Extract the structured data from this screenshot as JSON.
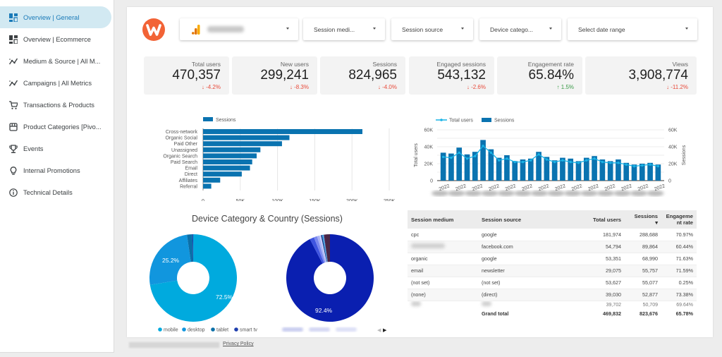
{
  "sidebar": {
    "items": [
      {
        "label": "Overview | General",
        "icon": "dashboard-icon",
        "active": true
      },
      {
        "label": "Overview | Ecommerce",
        "icon": "dashboard-icon",
        "active": false
      },
      {
        "label": "Medium & Source | All M...",
        "icon": "trend-icon",
        "active": false
      },
      {
        "label": "Campaigns | All Metrics",
        "icon": "trend-icon",
        "active": false
      },
      {
        "label": "Transactions & Products",
        "icon": "cart-icon",
        "active": false
      },
      {
        "label": "Product Categories [Pivo...",
        "icon": "store-icon",
        "active": false
      },
      {
        "label": "Events",
        "icon": "trophy-icon",
        "active": false
      },
      {
        "label": "Internal Promotions",
        "icon": "lightbulb-icon",
        "active": false
      },
      {
        "label": "Technical Details",
        "icon": "info-icon",
        "active": false
      }
    ]
  },
  "filters": {
    "account": {
      "icon": "analytics-icon",
      "value": ""
    },
    "session_medium": "Session medi...",
    "session_source": "Session source",
    "device_category": "Device catego...",
    "date_range": "Select date range"
  },
  "colors": {
    "accent": "#1a7ab8",
    "bar": "#0a73b0",
    "line": "#19b3e6",
    "down": "#e84a3a",
    "up": "#3a9a48",
    "logo": "#f26336"
  },
  "kpis": [
    {
      "label": "Total users",
      "value": "470,357",
      "delta": "-4.2%",
      "direction": "down"
    },
    {
      "label": "New users",
      "value": "299,241",
      "delta": "-8.3%",
      "direction": "down"
    },
    {
      "label": "Sessions",
      "value": "824,965",
      "delta": "-4.0%",
      "direction": "down"
    },
    {
      "label": "Engaged sessions",
      "value": "543,132",
      "delta": "-2.6%",
      "direction": "down"
    },
    {
      "label": "Engagement rate",
      "value": "65.84%",
      "delta": "1.5%",
      "direction": "up"
    },
    {
      "label": "Views",
      "value": "3,908,774",
      "delta": "-11.2%",
      "direction": "down"
    }
  ],
  "chart_data": [
    {
      "type": "bar",
      "orientation": "horizontal",
      "legend": [
        "Sessions"
      ],
      "legend_position": "top-left",
      "categories": [
        "Cross-network",
        "Organic Social",
        "Paid Other",
        "Unassigned",
        "Organic Search",
        "Paid Search",
        "Email",
        "Direct",
        "Affiliates",
        "Referral"
      ],
      "values": [
        214000,
        116000,
        106000,
        77000,
        72000,
        66000,
        63000,
        52000,
        23000,
        11000
      ],
      "xlim": [
        0,
        250000
      ],
      "xticks": [
        "0",
        "50K",
        "100K",
        "150K",
        "200K",
        "250K"
      ],
      "grid": true
    },
    {
      "type": "bar+line",
      "legend": [
        "Total users",
        "Sessions"
      ],
      "legend_position": "top-left",
      "ylabel_left": "Total users",
      "ylabel_right": "Sessions",
      "yticks": [
        "0",
        "20K",
        "40K",
        "60K"
      ],
      "ylim": [
        0,
        60000
      ],
      "x_tick_labels": [
        "2022",
        "2022",
        "2022",
        "2022",
        "2022",
        "2022",
        "2022",
        "2022",
        "2022",
        "2022",
        "2022",
        "2022",
        "2022",
        "2022"
      ],
      "series": [
        {
          "name": "Sessions",
          "kind": "bar",
          "values": [
            33000,
            32000,
            39000,
            31000,
            34000,
            48000,
            37000,
            27000,
            30000,
            23000,
            25000,
            26000,
            34000,
            28000,
            24000,
            27000,
            26000,
            23000,
            27000,
            29000,
            25000,
            23000,
            25000,
            21000,
            19000,
            20000,
            21000,
            19000
          ]
        },
        {
          "name": "Total users",
          "kind": "line",
          "values": [
            28000,
            27000,
            33000,
            26000,
            29000,
            41000,
            33000,
            24000,
            26000,
            22000,
            22000,
            24000,
            31000,
            25000,
            22000,
            24000,
            22000,
            21000,
            24000,
            26000,
            22000,
            21000,
            21000,
            19000,
            17000,
            18000,
            19000,
            17000
          ]
        }
      ],
      "grid": true
    },
    {
      "type": "pie",
      "variant": "donut",
      "title": "Device Category & Country (Sessions)",
      "slices": [
        {
          "label": "mobile",
          "value": 72.5,
          "color": "#00aade"
        },
        {
          "label": "desktop",
          "value": 25.2,
          "color": "#1196de"
        },
        {
          "label": "tablet",
          "value": 2.0,
          "color": "#0b6fa8"
        },
        {
          "label": "smart tv",
          "value": 0.3,
          "color": "#1f3fae"
        }
      ],
      "data_labels": [
        "72.5%",
        "25.2%"
      ],
      "legend_position": "bottom"
    },
    {
      "type": "pie",
      "variant": "donut",
      "slices": [
        {
          "label": "",
          "value": 92.4,
          "color": "#0a1fb0"
        },
        {
          "label": "",
          "value": 1.6,
          "color": "#3f55e0"
        },
        {
          "label": "",
          "value": 1.2,
          "color": "#7a88ef"
        },
        {
          "label": "",
          "value": 0.9,
          "color": "#a9b2f5"
        },
        {
          "label": "",
          "value": 0.6,
          "color": "#c9cffa"
        },
        {
          "label": "",
          "value": 0.4,
          "color": "#0e2680"
        },
        {
          "label": "",
          "value": 0.4,
          "color": "#3bb0e0"
        },
        {
          "label": "",
          "value": 0.3,
          "color": "#5577cc"
        },
        {
          "label": "",
          "value": 2.2,
          "color": "#4a2646"
        }
      ],
      "data_labels": [
        "92.4%"
      ],
      "legend_position": "bottom"
    }
  ],
  "table": {
    "headers": [
      "Session medium",
      "Session source",
      "Total users",
      "Sessions",
      "Engageme nt rate"
    ],
    "sort_indicator": "▾",
    "rows": [
      [
        "cpc",
        "google",
        "181,974",
        "288,688",
        "70.97%"
      ],
      [
        "",
        "facebook.com",
        "54,794",
        "89,864",
        "60.44%"
      ],
      [
        "organic",
        "google",
        "53,351",
        "68,990",
        "71.63%"
      ],
      [
        "email",
        "newsletter",
        "29,075",
        "55,757",
        "71.59%"
      ],
      [
        "(not set)",
        "(not set)",
        "53,627",
        "55,077",
        "0.25%"
      ],
      [
        "(none)",
        "(direct)",
        "39,030",
        "52,877",
        "73.38%"
      ],
      [
        "",
        "",
        "39,702",
        "50,709",
        "69.64%"
      ]
    ],
    "total": [
      "",
      "Grand total",
      "469,832",
      "823,676",
      "65.78%"
    ]
  },
  "footer": {
    "privacy_link": "Privacy Policy"
  }
}
